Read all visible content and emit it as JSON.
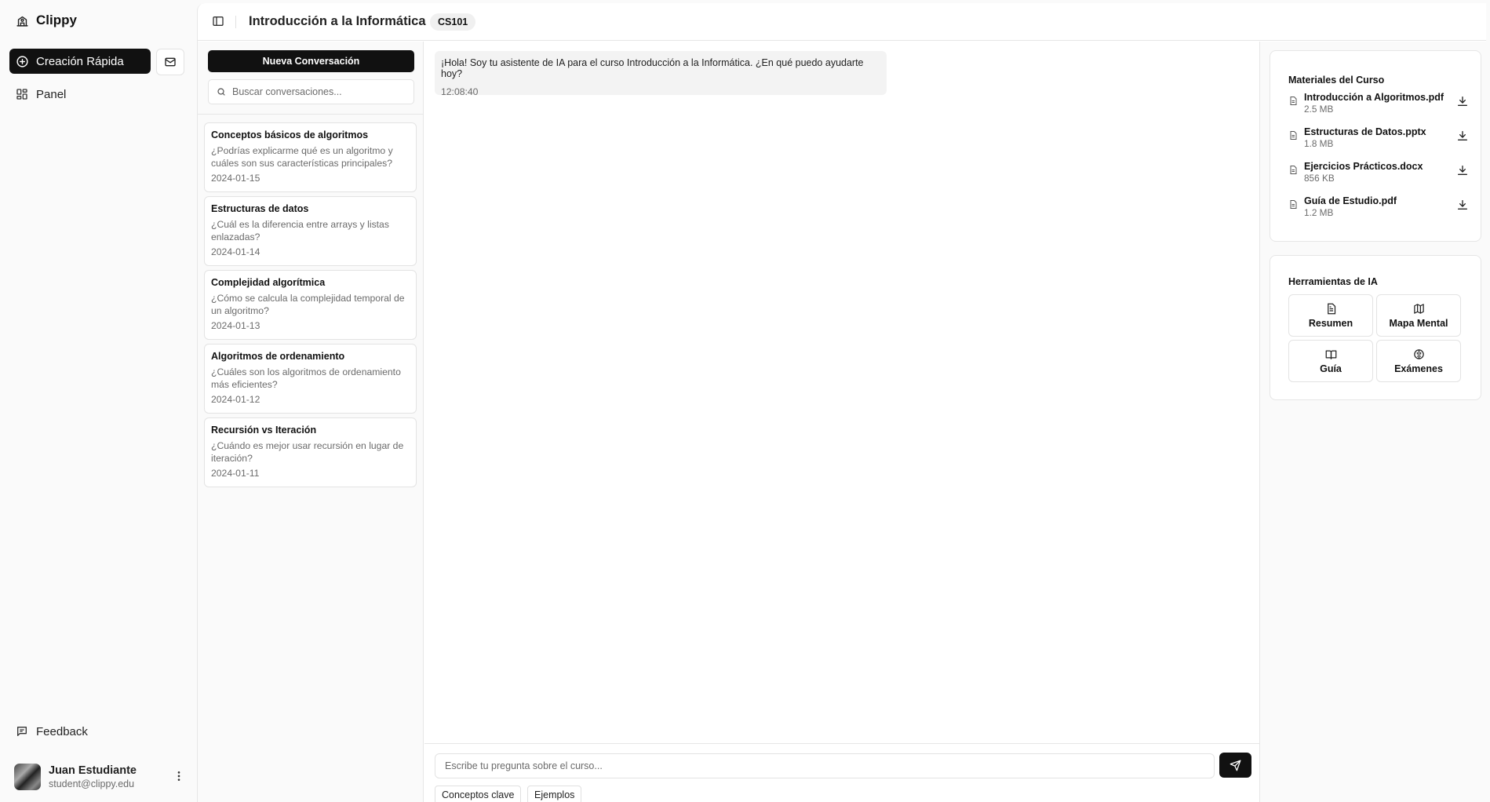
{
  "app": {
    "name": "Clippy",
    "quick_create_label": "Creación Rápida",
    "nav": [
      {
        "label": "Panel",
        "icon": "dashboard-icon"
      }
    ],
    "feedback_label": "Feedback",
    "user": {
      "name": "Juan Estudiante",
      "email": "student@clippy.edu"
    }
  },
  "header": {
    "course_title": "Introducción a la Informática",
    "course_code": "CS101"
  },
  "conversations": {
    "new_label": "Nueva Conversación",
    "search_placeholder": "Buscar conversaciones...",
    "items": [
      {
        "title": "Conceptos básicos de algoritmos",
        "preview": "¿Podrías explicarme qué es un algoritmo y cuáles son sus características principales?",
        "date": "2024-01-15"
      },
      {
        "title": "Estructuras de datos",
        "preview": "¿Cuál es la diferencia entre arrays y listas enlazadas?",
        "date": "2024-01-14"
      },
      {
        "title": "Complejidad algorítmica",
        "preview": "¿Cómo se calcula la complejidad temporal de un algoritmo?",
        "date": "2024-01-13"
      },
      {
        "title": "Algoritmos de ordenamiento",
        "preview": "¿Cuáles son los algoritmos de ordenamiento más eficientes?",
        "date": "2024-01-12"
      },
      {
        "title": "Recursión vs Iteración",
        "preview": "¿Cuándo es mejor usar recursión en lugar de iteración?",
        "date": "2024-01-11"
      }
    ]
  },
  "chat": {
    "messages": [
      {
        "text": "¡Hola! Soy tu asistente de IA para el curso Introducción a la Informática. ¿En qué puedo ayudarte hoy?",
        "time": "12:08:40"
      }
    ],
    "input_placeholder": "Escribe tu pregunta sobre el curso...",
    "chips": [
      "Conceptos clave",
      "Ejemplos"
    ]
  },
  "materials": {
    "title": "Materiales del Curso",
    "items": [
      {
        "name": "Introducción a Algoritmos.pdf",
        "size": "2.5 MB"
      },
      {
        "name": "Estructuras de Datos.pptx",
        "size": "1.8 MB"
      },
      {
        "name": "Ejercicios Prácticos.docx",
        "size": "856 KB"
      },
      {
        "name": "Guía de Estudio.pdf",
        "size": "1.2 MB"
      }
    ]
  },
  "ai_tools": {
    "title": "Herramientas de IA",
    "items": [
      {
        "label": "Resumen",
        "icon": "document-icon"
      },
      {
        "label": "Mapa Mental",
        "icon": "map-icon"
      },
      {
        "label": "Guía",
        "icon": "book-icon"
      },
      {
        "label": "Exámenes",
        "icon": "brain-icon"
      }
    ]
  }
}
